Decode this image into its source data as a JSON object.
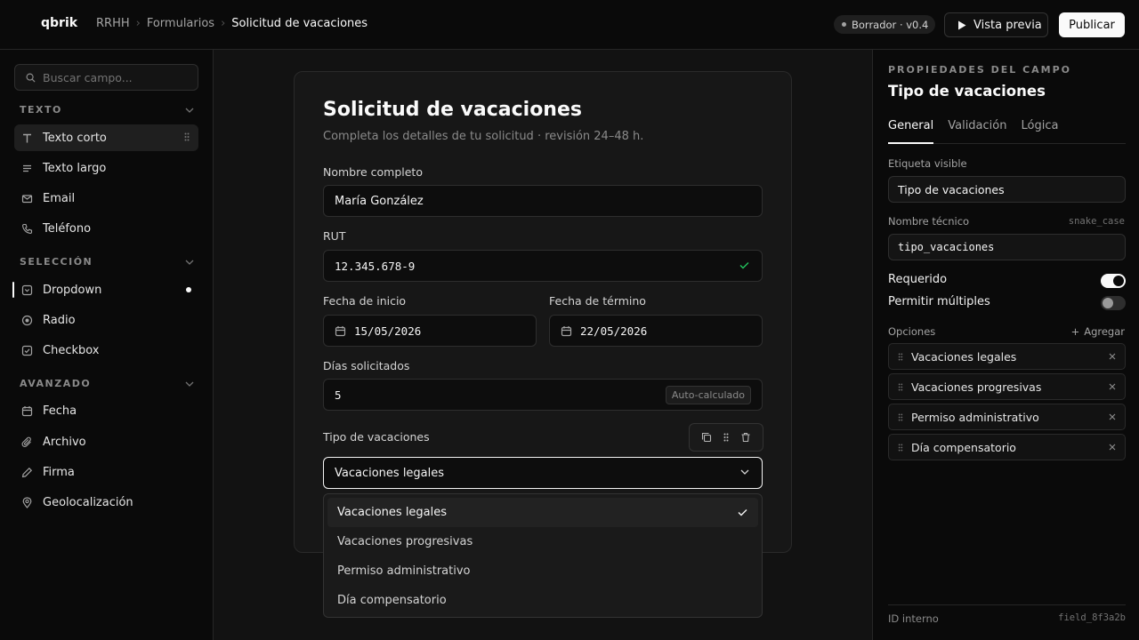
{
  "app": {
    "brand": "qbrik"
  },
  "breadcrumb": [
    "RRHH",
    "Formularios",
    "Solicitud de vacaciones"
  ],
  "status_badge": "Borrador · v0.4",
  "preview_label": "Vista previa",
  "publish_label": "Publicar",
  "sidebar": {
    "search_placeholder": "Buscar campo...",
    "sections": [
      {
        "title": "TEXTO",
        "items": [
          "Texto corto",
          "Texto largo",
          "Email",
          "Teléfono"
        ]
      },
      {
        "title": "SELECCIÓN",
        "items": [
          "Dropdown",
          "Radio",
          "Checkbox"
        ]
      },
      {
        "title": "AVANZADO",
        "items": [
          "Fecha",
          "Archivo",
          "Firma",
          "Geolocalización"
        ]
      }
    ]
  },
  "form": {
    "title": "Solicitud de vacaciones",
    "subtitle": "Completa los detalles de tu solicitud · revisión 24–48 h.",
    "nombre": {
      "label": "Nombre completo",
      "value": "María González"
    },
    "rut": {
      "label": "RUT",
      "value": "12.345.678-9"
    },
    "inicio": {
      "label": "Fecha de inicio",
      "value": "15/05/2026"
    },
    "termino": {
      "label": "Fecha de término",
      "value": "22/05/2026"
    },
    "dias": {
      "label": "Días solicitados",
      "value": "5",
      "chip": "Auto-calculado"
    },
    "tipo": {
      "label": "Tipo de vacaciones",
      "value": "Vacaciones legales",
      "options": [
        "Vacaciones legales",
        "Vacaciones progresivas",
        "Permiso administrativo",
        "Día compensatorio"
      ]
    }
  },
  "props": {
    "kicker": "PROPIEDADES DEL CAMPO",
    "title": "Tipo de vacaciones",
    "tabs": [
      "General",
      "Validación",
      "Lógica"
    ],
    "etiqueta_label": "Etiqueta visible",
    "etiqueta_value": "Tipo de vacaciones",
    "tecnico_label": "Nombre técnico",
    "tecnico_hint": "snake_case",
    "tecnico_value": "tipo_vacaciones",
    "requerido_label": "Requerido",
    "requerido": true,
    "multiples_label": "Permitir múltiples",
    "multiples": false,
    "opciones_label": "Opciones",
    "agregar_label": "Agregar",
    "opciones": [
      "Vacaciones legales",
      "Vacaciones progresivas",
      "Permiso administrativo",
      "Día compensatorio"
    ],
    "id_label": "ID interno",
    "id_value": "field_8f3a2b"
  },
  "colors": {
    "background": "#0a0a0a",
    "canvas": "#121212",
    "card": "#171717",
    "accent": "#fafafa",
    "success": "#22c55e"
  }
}
